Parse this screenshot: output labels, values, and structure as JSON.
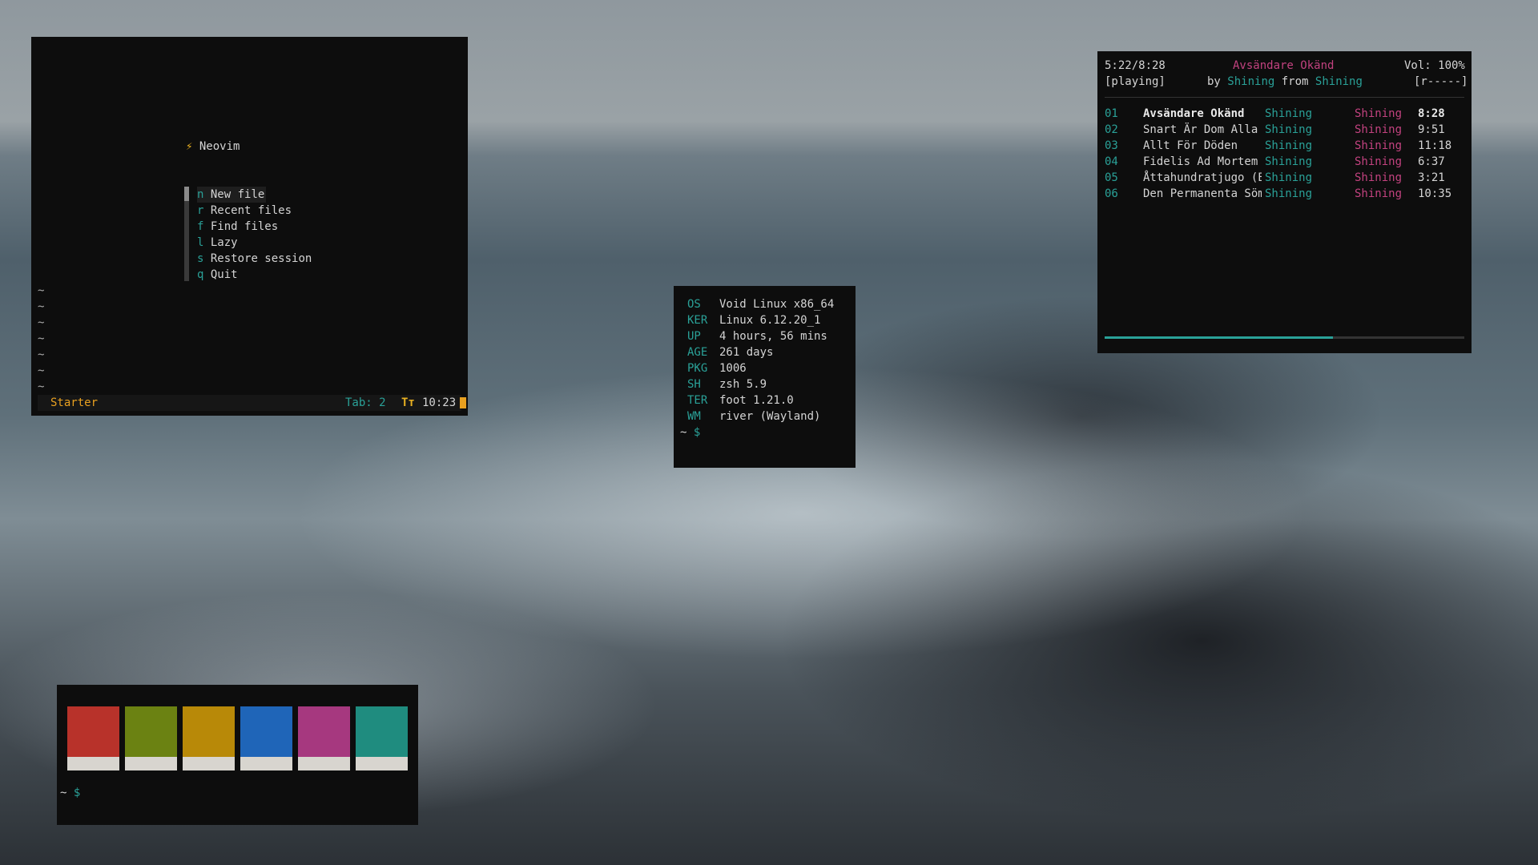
{
  "nvim": {
    "title": "Neovim",
    "menu": [
      {
        "key": "n",
        "label": "New file"
      },
      {
        "key": "r",
        "label": "Recent files"
      },
      {
        "key": "f",
        "label": "Find files"
      },
      {
        "key": "l",
        "label": "Lazy"
      },
      {
        "key": "s",
        "label": "Restore session"
      },
      {
        "key": "q",
        "label": "Quit"
      }
    ],
    "tilde": "~",
    "status": {
      "mode": "Starter",
      "tab": "Tab: 2",
      "font_icon": "Tт",
      "clock": "10:23"
    }
  },
  "fetch": {
    "rows": [
      {
        "key": "OS",
        "value": "Void Linux x86_64"
      },
      {
        "key": "KER",
        "value": "Linux 6.12.20_1"
      },
      {
        "key": "UP",
        "value": "4 hours, 56 mins"
      },
      {
        "key": "AGE",
        "value": "261 days"
      },
      {
        "key": "PKG",
        "value": "1006"
      },
      {
        "key": "SH",
        "value": "zsh 5.9"
      },
      {
        "key": "TER",
        "value": "foot 1.21.0"
      },
      {
        "key": "WM",
        "value": "river (Wayland)"
      }
    ],
    "prompt_tilde": "~",
    "prompt_symbol": "$"
  },
  "music": {
    "position": "5:22/8:28",
    "now_title": "Avsändare Okänd",
    "volume": "Vol: 100%",
    "state": "[playing]",
    "by": "by",
    "artist": "Shining",
    "from": "from",
    "album": "Shining",
    "flags": "[r-----]",
    "progress_fraction": 0.634,
    "tracks": [
      {
        "num": "01",
        "title": "Avsändare Okänd",
        "artist": "Shining",
        "album": "Shining",
        "length": "8:28"
      },
      {
        "num": "02",
        "title": "Snart Är Dom Alla",
        "artist": "Shining",
        "album": "Shining",
        "length": "9:51"
      },
      {
        "num": "03",
        "title": "Allt För Döden",
        "artist": "Shining",
        "album": "Shining",
        "length": "11:18"
      },
      {
        "num": "04",
        "title": "Fidelis Ad Mortem",
        "artist": "Shining",
        "album": "Shining",
        "length": "6:37"
      },
      {
        "num": "05",
        "title": "Åttahundratjugo (E",
        "artist": "Shining",
        "album": "Shining",
        "length": "3:21"
      },
      {
        "num": "06",
        "title": "Den Permanenta Söm",
        "artist": "Shining",
        "album": "Shining",
        "length": "10:35"
      }
    ]
  },
  "colors": {
    "swatches": [
      "#b8322a",
      "#6b8212",
      "#b88908",
      "#1f65b8",
      "#a6387f",
      "#1f8c7f"
    ],
    "bottom": "#d8d5cf",
    "prompt_tilde": "~",
    "prompt_symbol": "$"
  }
}
